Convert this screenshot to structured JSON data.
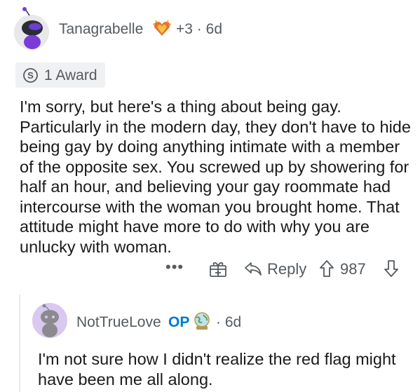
{
  "comment": {
    "username": "Tanagrabelle",
    "award_count_badge": "+3",
    "separator": "·",
    "age": "6d",
    "awards_label": "1 Award",
    "body": "I'm sorry, but here's a thing about being gay. Particularly in the modern day, they don't have to hide being gay by doing anything intimate with a member of the opposite sex. You screwed up by showering for half an hour, and believing your gay roommate had intercourse with the woman you brought home. That attitude might have more to do with why you are unlucky with woman.",
    "actions": {
      "more": "•••",
      "reply_label": "Reply",
      "score": "987"
    }
  },
  "reply": {
    "username": "NotTrueLove",
    "op_label": "OP",
    "separator": "·",
    "age": "6d",
    "body": "I'm not sure how I didn't realize the red flag might have been me all along."
  },
  "colors": {
    "meta_text": "#555a5e",
    "body_text": "#1a1a1b",
    "op_blue": "#0079d3",
    "award_bg": "#f0f1f2",
    "avatar1_purple": "#7a3bd8",
    "avatar2_lavender": "#d9c8ef"
  },
  "icons": [
    "avatar-snoo",
    "flair-heart-icon",
    "award-silver-icon",
    "more-icon",
    "gift-icon",
    "reply-icon",
    "upvote-icon",
    "downvote-icon",
    "flair-globe-icon"
  ]
}
